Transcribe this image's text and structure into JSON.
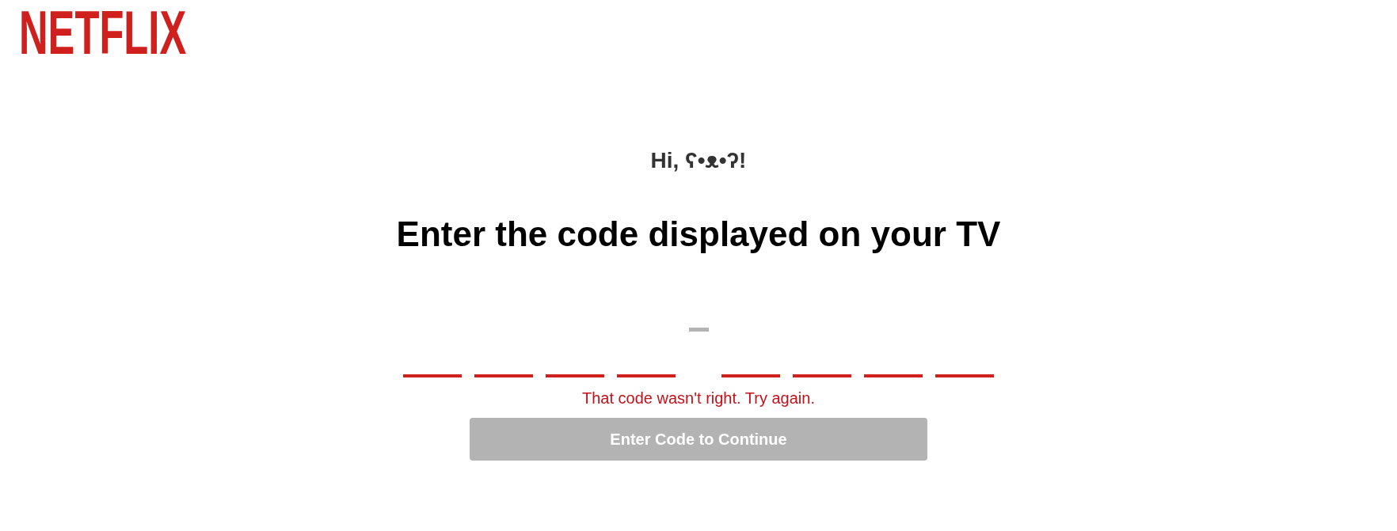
{
  "logo": {
    "text": "NETFLIX"
  },
  "greeting": "Hi, ʕ•ᴥ•ʔ!",
  "title": "Enter the code displayed on your TV",
  "code_input": {
    "groups": [
      {
        "fields": [
          {
            "invalid": true
          },
          {
            "invalid": true
          },
          {
            "invalid": true
          },
          {
            "invalid": true
          }
        ]
      },
      {
        "fields": [
          {
            "invalid": true
          },
          {
            "invalid": true
          },
          {
            "invalid": true
          },
          {
            "invalid": true
          }
        ]
      }
    ],
    "error": "That code wasn't right. Try again."
  },
  "submit_button": {
    "label": "Enter Code to Continue",
    "disabled": true
  }
}
